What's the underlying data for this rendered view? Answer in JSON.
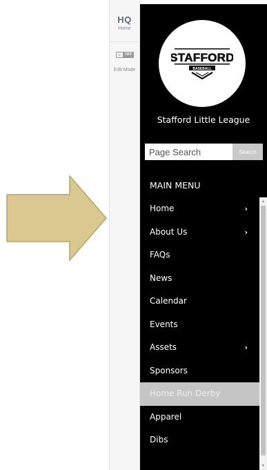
{
  "hq_strip": {
    "logo": "HQ",
    "home_label": "Home",
    "edit_toggle_state": "OFF",
    "edit_toggle_knob": "II",
    "edit_mode_label": "Edit Mode"
  },
  "sidebar": {
    "logo_text": "STAFFORD",
    "logo_subtext": "BASEBALL",
    "league_name": "Stafford Little League",
    "search": {
      "placeholder": "Page Search",
      "button_label": "Search"
    },
    "menu_heading": "MAIN MENU",
    "menu_items": [
      {
        "label": "Home",
        "has_submenu": true,
        "chevron": "›"
      },
      {
        "label": "About Us",
        "has_submenu": true,
        "chevron": "›"
      },
      {
        "label": "FAQs",
        "has_submenu": false
      },
      {
        "label": "News",
        "has_submenu": false
      },
      {
        "label": "Calendar",
        "has_submenu": false
      },
      {
        "label": "Events",
        "has_submenu": false
      },
      {
        "label": "Assets",
        "has_submenu": true,
        "chevron": "›"
      },
      {
        "label": "Sponsors",
        "has_submenu": false
      },
      {
        "label": "Home Run Derby",
        "has_submenu": false,
        "active": true
      },
      {
        "label": "Apparel",
        "has_submenu": false
      },
      {
        "label": "Dibs",
        "has_submenu": false
      }
    ],
    "scroll_up_glyph": "▲",
    "scroll_down_glyph": "▼"
  },
  "colors": {
    "arrow_fill": "#d9c88f",
    "arrow_stroke": "#b5a36a",
    "sidebar_bg": "#000000",
    "active_item_bg": "#c5c5c5",
    "hq_logo": "#5e6b7a"
  }
}
